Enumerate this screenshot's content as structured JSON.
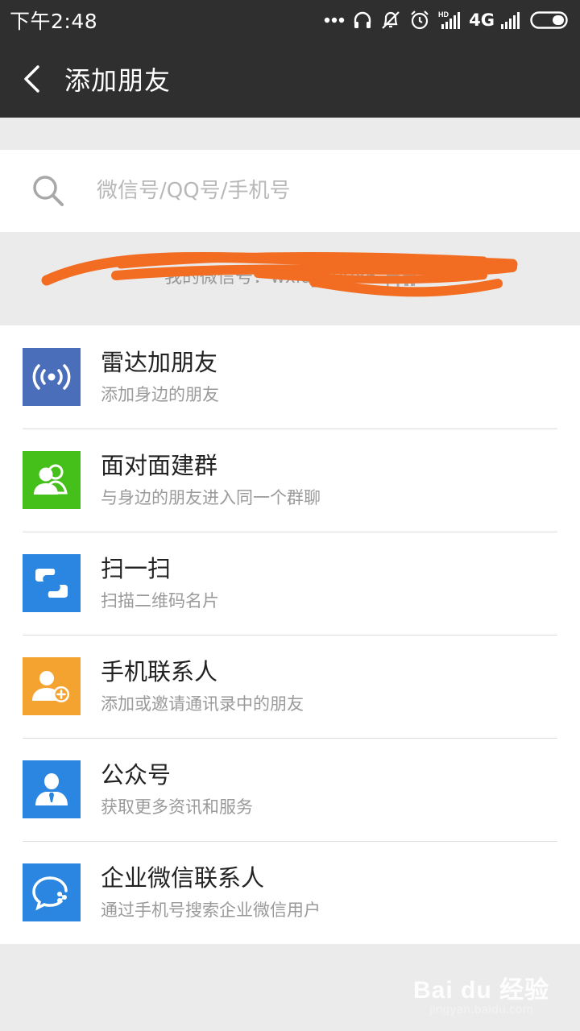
{
  "status_bar": {
    "time": "下午2:48",
    "network": "4G",
    "icons": [
      "more-dots-icon",
      "headphones-icon",
      "bell-off-icon",
      "alarm-icon",
      "signal-hd-icon",
      "signal-icon",
      "battery-icon"
    ]
  },
  "header": {
    "back_icon": "chevron-left-icon",
    "title": "添加朋友"
  },
  "search": {
    "placeholder": "微信号/QQ号/手机号",
    "value": ""
  },
  "my_id": {
    "text": "我的微信号：wxid_10086",
    "qr_icon": "qr-code-icon",
    "redacted": true
  },
  "menu": {
    "items": [
      {
        "id": "radar",
        "title": "雷达加朋友",
        "subtitle": "添加身边的朋友",
        "icon": "radar-icon",
        "color": "#4a6eb9"
      },
      {
        "id": "face-group",
        "title": "面对面建群",
        "subtitle": "与身边的朋友进入同一个群聊",
        "icon": "group-icon",
        "color": "#45c01a"
      },
      {
        "id": "scan",
        "title": "扫一扫",
        "subtitle": "扫描二维码名片",
        "icon": "scan-icon",
        "color": "#2a86e0"
      },
      {
        "id": "contacts",
        "title": "手机联系人",
        "subtitle": "添加或邀请通讯录中的朋友",
        "icon": "add-contact-icon",
        "color": "#f5a330"
      },
      {
        "id": "official",
        "title": "公众号",
        "subtitle": "获取更多资讯和服务",
        "icon": "official-account-icon",
        "color": "#2a86e0"
      },
      {
        "id": "work",
        "title": "企业微信联系人",
        "subtitle": "通过手机号搜索企业微信用户",
        "icon": "work-chat-icon",
        "color": "#2a86e0"
      }
    ]
  },
  "watermark": {
    "logo": "Bai du 经验",
    "url": "jingyan.baidu.com"
  }
}
